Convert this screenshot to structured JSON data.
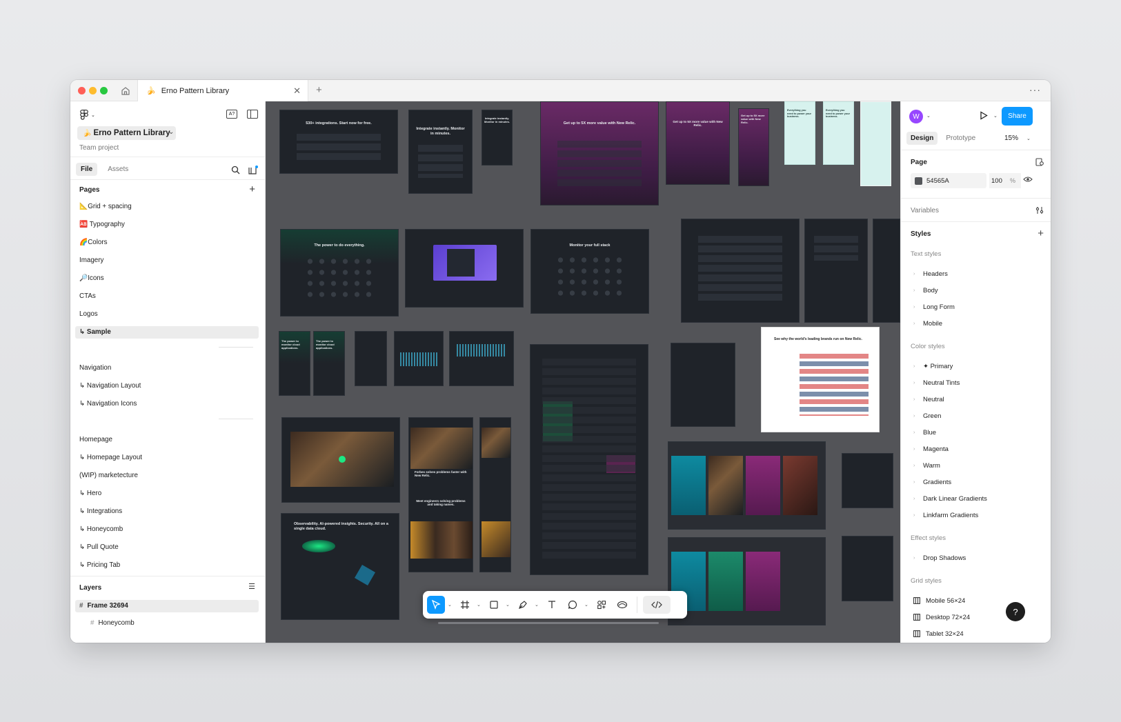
{
  "app": {
    "tab_title": "Erno Pattern Library",
    "tab_icon": "banana-icon"
  },
  "left": {
    "project_name": "Erno Pattern Library",
    "project_sub": "Team project",
    "file_tabs": [
      "File",
      "Assets"
    ],
    "pages_title": "Pages",
    "pages": [
      {
        "label": "📐Grid + spacing",
        "selected": false
      },
      {
        "label": "🆎 Typography",
        "selected": false
      },
      {
        "label": "🌈Colors",
        "selected": false
      },
      {
        "label": "Imagery",
        "selected": false
      },
      {
        "label": "🔎Icons",
        "selected": false
      },
      {
        "label": "CTAs",
        "selected": false
      },
      {
        "label": "Logos",
        "selected": false
      },
      {
        "label": "↳ Sample",
        "selected": true
      }
    ],
    "nav_group": [
      "Navigation",
      "↳ Navigation Layout",
      "↳ Navigation Icons"
    ],
    "home_group": [
      "Homepage",
      "↳ Homepage Layout",
      "(WIP) marketecture",
      "↳ Hero",
      "↳ Integrations",
      "↳ Honeycomb",
      "↳ Pull Quote",
      "↳ Pricing Tab"
    ],
    "layers_title": "Layers",
    "layers": [
      {
        "label": "Frame 32694",
        "selected": true
      },
      {
        "label": "Honeycomb",
        "selected": false
      }
    ]
  },
  "canvas": {
    "background": "#535458",
    "frame_texts": {
      "integrations": "530+ integrations. Start now for free.",
      "integrate": "Integrate instantly. Monitor in minutes.",
      "integrate_small": "Integrate instantly. Monitor in minutes.",
      "value_5x": "Get up to 5X more value with New Relic.",
      "value_5x_b": "Get up to 5X more value with New Relic.",
      "value_5x_c": "Get up to 5X more value with New Relic.",
      "everything": "Everything you need to power your business.",
      "power": "The power to do everything.",
      "full_stack": "Monitor your full stack",
      "monitor_cloud": "The power to monitor cloud applications.",
      "forbes": "Forbes solves problems faster with New Relic.",
      "engineers": "Meet engineers solving problems and taking names.",
      "observability": "Observability. AI-powered insights. Security. All on a single data cloud.",
      "brands": "See why the world's leading brands run on New Relic."
    }
  },
  "toolbar": {
    "tools": [
      "move-tool",
      "frame-tool",
      "shape-tool",
      "pen-tool",
      "text-tool",
      "comment-tool",
      "actions-tool",
      "ai-tool",
      "dev-mode-toggle"
    ],
    "active_tool": "move-tool"
  },
  "right": {
    "avatar_letter": "W",
    "avatar_color": "#9747ff",
    "share_label": "Share",
    "tabs": [
      "Design",
      "Prototype"
    ],
    "zoom": "15%",
    "page_title": "Page",
    "page_color": "54565A",
    "page_opacity": "100",
    "pct": "%",
    "variables_title": "Variables",
    "styles_title": "Styles",
    "text_styles_title": "Text styles",
    "text_styles": [
      "Headers",
      "Body",
      "Long Form",
      "Mobile"
    ],
    "color_styles_title": "Color styles",
    "color_styles": [
      "✦ Primary",
      "Neutral Tints",
      "Neutral",
      "Green",
      "Blue",
      "Magenta",
      "Warm",
      "Gradients",
      "Dark Linear Gradients",
      "Linkfarm Gradients"
    ],
    "effect_styles_title": "Effect styles",
    "effect_styles": [
      "Drop Shadows"
    ],
    "grid_styles_title": "Grid styles",
    "grid_styles": [
      "Mobile 56×24",
      "Desktop 72×24",
      "Tablet 32×24"
    ],
    "help": "?"
  },
  "colors": {
    "accent": "#0d99ff",
    "canvas": "#535458"
  }
}
